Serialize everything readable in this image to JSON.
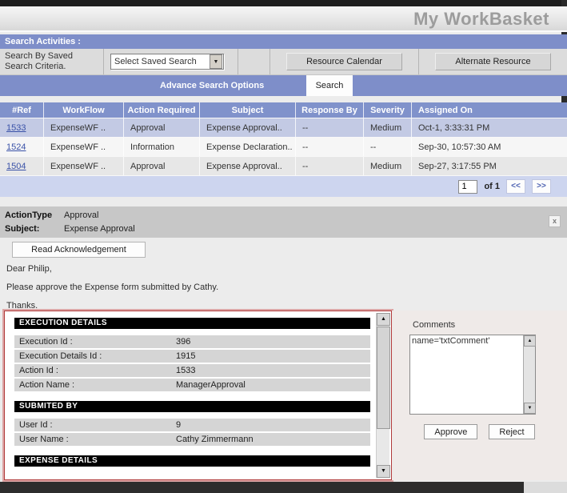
{
  "window": {
    "title": "My WorkBasket"
  },
  "search": {
    "section_title": "Search Activities :",
    "criteria_label": "Search By Saved Search Criteria.",
    "saved_search_value": "Select Saved Search",
    "resource_calendar": "Resource Calendar",
    "alternate_resource": "Alternate Resource",
    "advance_options": "Advance Search Options",
    "search_button": "Search"
  },
  "worklist": {
    "columns": [
      "#Ref",
      "WorkFlow",
      "Action Required",
      "Subject",
      "Response By",
      "Severity",
      "Assigned On"
    ],
    "rows": [
      {
        "ref": "1533",
        "workflow": "ExpenseWF ..",
        "action": "Approval",
        "subject": "Expense Approval..",
        "response_by": "--",
        "severity": "Medium",
        "assigned_on": "Oct-1, 3:33:31 PM"
      },
      {
        "ref": "1524",
        "workflow": "ExpenseWF ..",
        "action": "Information",
        "subject": "Expense Declaration..",
        "response_by": "--",
        "severity": "--",
        "assigned_on": "Sep-30, 10:57:30 AM"
      },
      {
        "ref": "1504",
        "workflow": "ExpenseWF ..",
        "action": "Approval",
        "subject": "Expense Approval..",
        "response_by": "--",
        "severity": "Medium",
        "assigned_on": "Sep-27, 3:17:55 PM"
      }
    ],
    "pagination": {
      "page": "1",
      "of": "of 1",
      "prev": "<<",
      "next": ">>"
    }
  },
  "task": {
    "action_type_label": "ActionType",
    "action_type": "Approval",
    "subject_label": "Subject:",
    "subject": "Expense Approval",
    "close": "x",
    "read_ack": "Read Acknowledgement",
    "message": [
      "Dear Philip,",
      "Please approve the Expense form submitted by Cathy.",
      "Thanks."
    ],
    "sections": [
      {
        "title": "EXECUTION DETAILS",
        "rows": [
          [
            "Execution Id :",
            "396"
          ],
          [
            "Execution Details Id :",
            "1915"
          ],
          [
            "Action Id :",
            "1533"
          ],
          [
            "Action Name :",
            "ManagerApproval"
          ]
        ]
      },
      {
        "title": "SUBMITED BY",
        "rows": [
          [
            "User Id :",
            "9"
          ],
          [
            "User Name :",
            "Cathy Zimmermann"
          ]
        ]
      },
      {
        "title": "EXPENSE DETAILS",
        "rows": []
      }
    ]
  },
  "comments": {
    "label": "Comments",
    "value": "name='txtComment'",
    "approve": "Approve",
    "reject": "Reject"
  },
  "colors": {
    "accent_blue": "#7E8EC9",
    "table_header_blue": "#8092CB",
    "selected_row": "#C3CAE4",
    "pagination_bg": "#CDD5EF",
    "panel_border_red": "#B03A3A",
    "section_header_bg": "#000000",
    "title_gray": "#9C9C9C"
  }
}
